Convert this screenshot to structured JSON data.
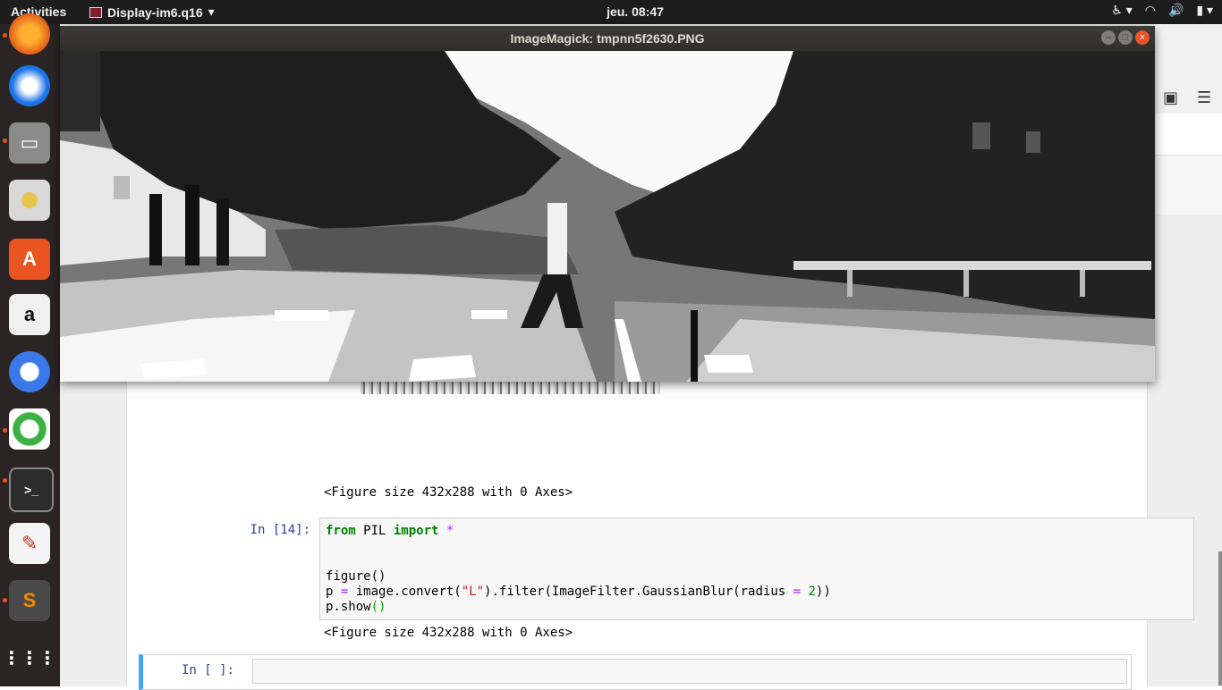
{
  "topbar": {
    "activities": "Activities",
    "app_name": "Display-im6.q16",
    "clock": "jeu. 08:47"
  },
  "imagemagick": {
    "title": "ImageMagick: tmpnn5f2630.PNG"
  },
  "notebook": {
    "output_1": "<Figure size 432x288 with 0 Axes>",
    "prompt_14": "In [14]:",
    "code_line1_kw1": "from",
    "code_line1_mod": " PIL ",
    "code_line1_kw2": "import",
    "code_line1_star": " *",
    "code_line2": "figure()",
    "code_line3_p": "p ",
    "code_line3_eq": "=",
    "code_line3_a": " image.convert(",
    "code_line3_str": "\"L\"",
    "code_line3_b": ").filter(ImageFilter.GaussianBlur(radius ",
    "code_line3_eq2": "=",
    "code_line3_num": " 2",
    "code_line3_c": "))",
    "code_line4_a": "p.show",
    "code_line4_paren": "()",
    "output_2": "<Figure size 432x288 with 0 Axes>",
    "prompt_empty": "In [ ]:"
  },
  "dock": [
    "firefox-icon",
    "thunderbird-icon",
    "files-icon",
    "rhythmbox-icon",
    "software-center-icon",
    "amazon-icon",
    "chromium-icon",
    "anaconda-icon",
    "terminal-icon",
    "text-editor-icon",
    "sublime-text-icon",
    "show-apps-icon"
  ]
}
